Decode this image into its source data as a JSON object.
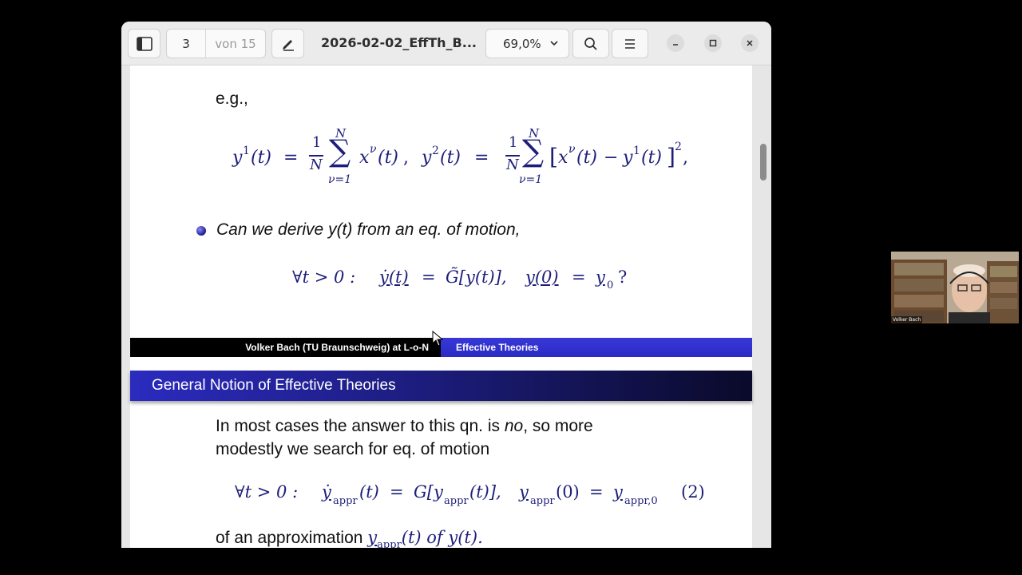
{
  "toolbar": {
    "page_current": "3",
    "page_total": "von 15",
    "document_title": "2026-02-02_EffTh_B...",
    "zoom": "69,0%"
  },
  "slide": {
    "eg_label": "e.g.,",
    "formula_means": {
      "y1_lhs": "y",
      "y1_sup": "1",
      "t_arg": "(t)",
      "equals": "=",
      "frac_num": "1",
      "frac_den": "N",
      "sum_upper": "N",
      "sum_lower": "ν=1",
      "x_term": "x",
      "x_sup": "ν",
      "y2_sup": "2",
      "minus": "−",
      "sq": "2",
      "comma": ","
    },
    "bullet_question": "Can we derive y(t) from an eq. of motion,",
    "eq_motion": {
      "forall": "∀t > 0 :",
      "lhs": "ẏ(t)",
      "eq1": "=",
      "rhs": "G̃[y(t)],",
      "init": "y(0)",
      "eq2": "=",
      "init_val": "y",
      "init_sub": "0",
      "qmark": "?"
    },
    "footer_left": "Volker Bach (TU Braunschweig) at L-o-N",
    "footer_right": "Effective Theories",
    "section_title": "General Notion of Effective Theories",
    "para_line1_a": "In most cases the answer to this qn. is ",
    "para_line1_em": "no",
    "para_line1_b": ", so more",
    "para_line2": "modestly we search for eq. of motion",
    "eq_appr": {
      "forall": "∀t > 0 :",
      "lhs": "ẏ",
      "lhs_sub": "appr",
      "t_arg": "(t)",
      "eq1": "=",
      "G": "G[y",
      "G_sub": "appr",
      "G_end": "(t)],",
      "init": "y",
      "init_sub": "appr",
      "init_arg": "(0)",
      "eq2": "=",
      "rhs": "y",
      "rhs_sub": "appr,0",
      "label": "(2)"
    },
    "para_line3_a": "of an approximation ",
    "para_line3_y": "y",
    "para_line3_sub": "appr",
    "para_line3_b": "(t) of ",
    "para_line3_c": "y(t)."
  },
  "webcam": {
    "name_label": "Volker Bach"
  },
  "colors": {
    "math_navy": "#1e1e7a",
    "footer_blue": "#3232d0",
    "section_gradient_start": "#2b2bbf"
  }
}
